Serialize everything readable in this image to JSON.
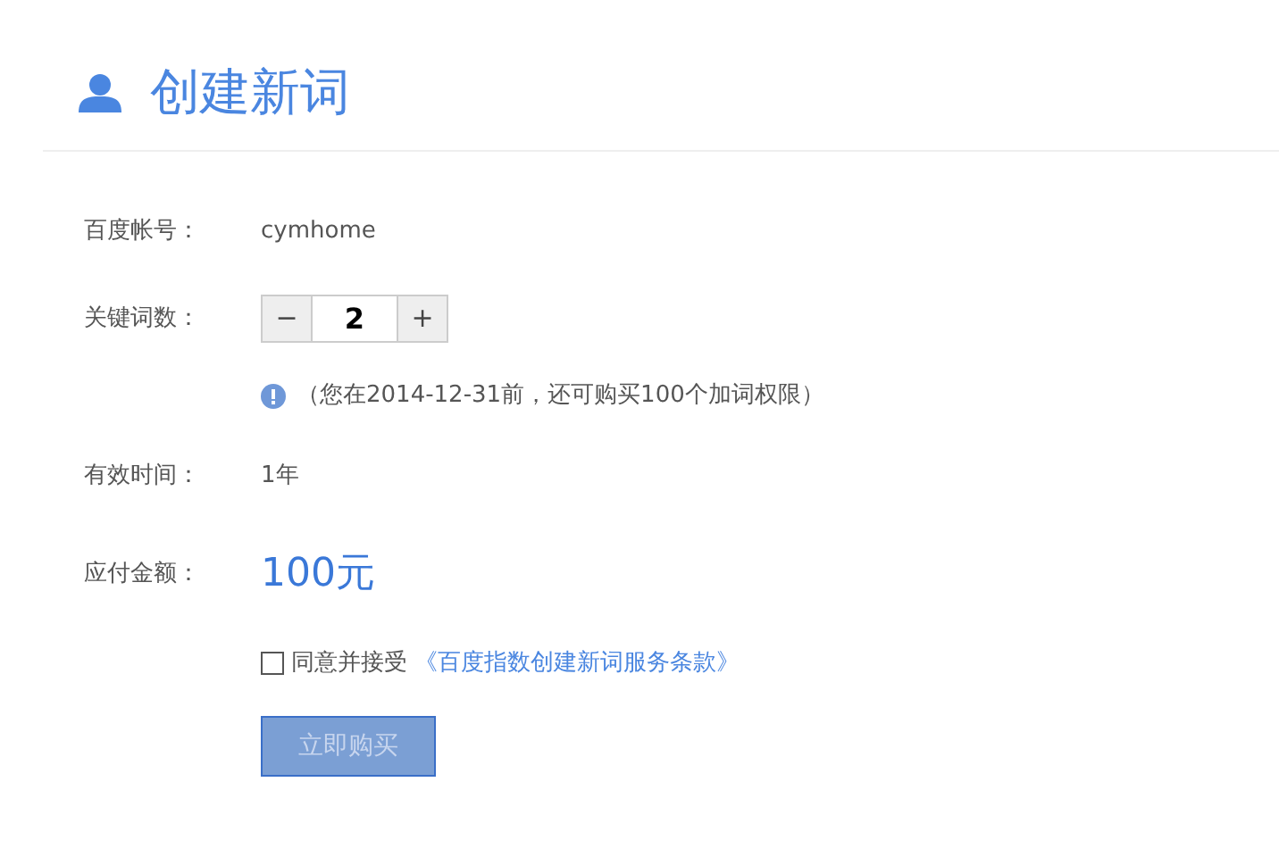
{
  "header": {
    "title": "创建新词"
  },
  "fields": [
    {
      "kind": "text",
      "label": "百度帐号：",
      "value": "cymhome"
    },
    {
      "kind": "stepper",
      "label": "关键词数：",
      "minus": "−",
      "value": "2",
      "plus": "+"
    },
    {
      "kind": "notice",
      "text": "（您在2014-12-31前，还可购买100个加词权限）"
    },
    {
      "kind": "text",
      "label": "有效时间：",
      "value": "1年"
    },
    {
      "kind": "price",
      "label": "应付金额：",
      "value": "100元"
    },
    {
      "kind": "agree",
      "checked": false,
      "text": "同意并接受",
      "link": "《百度指数创建新词服务条款》"
    },
    {
      "kind": "submit",
      "label": "立即购买",
      "disabled": true
    }
  ]
}
